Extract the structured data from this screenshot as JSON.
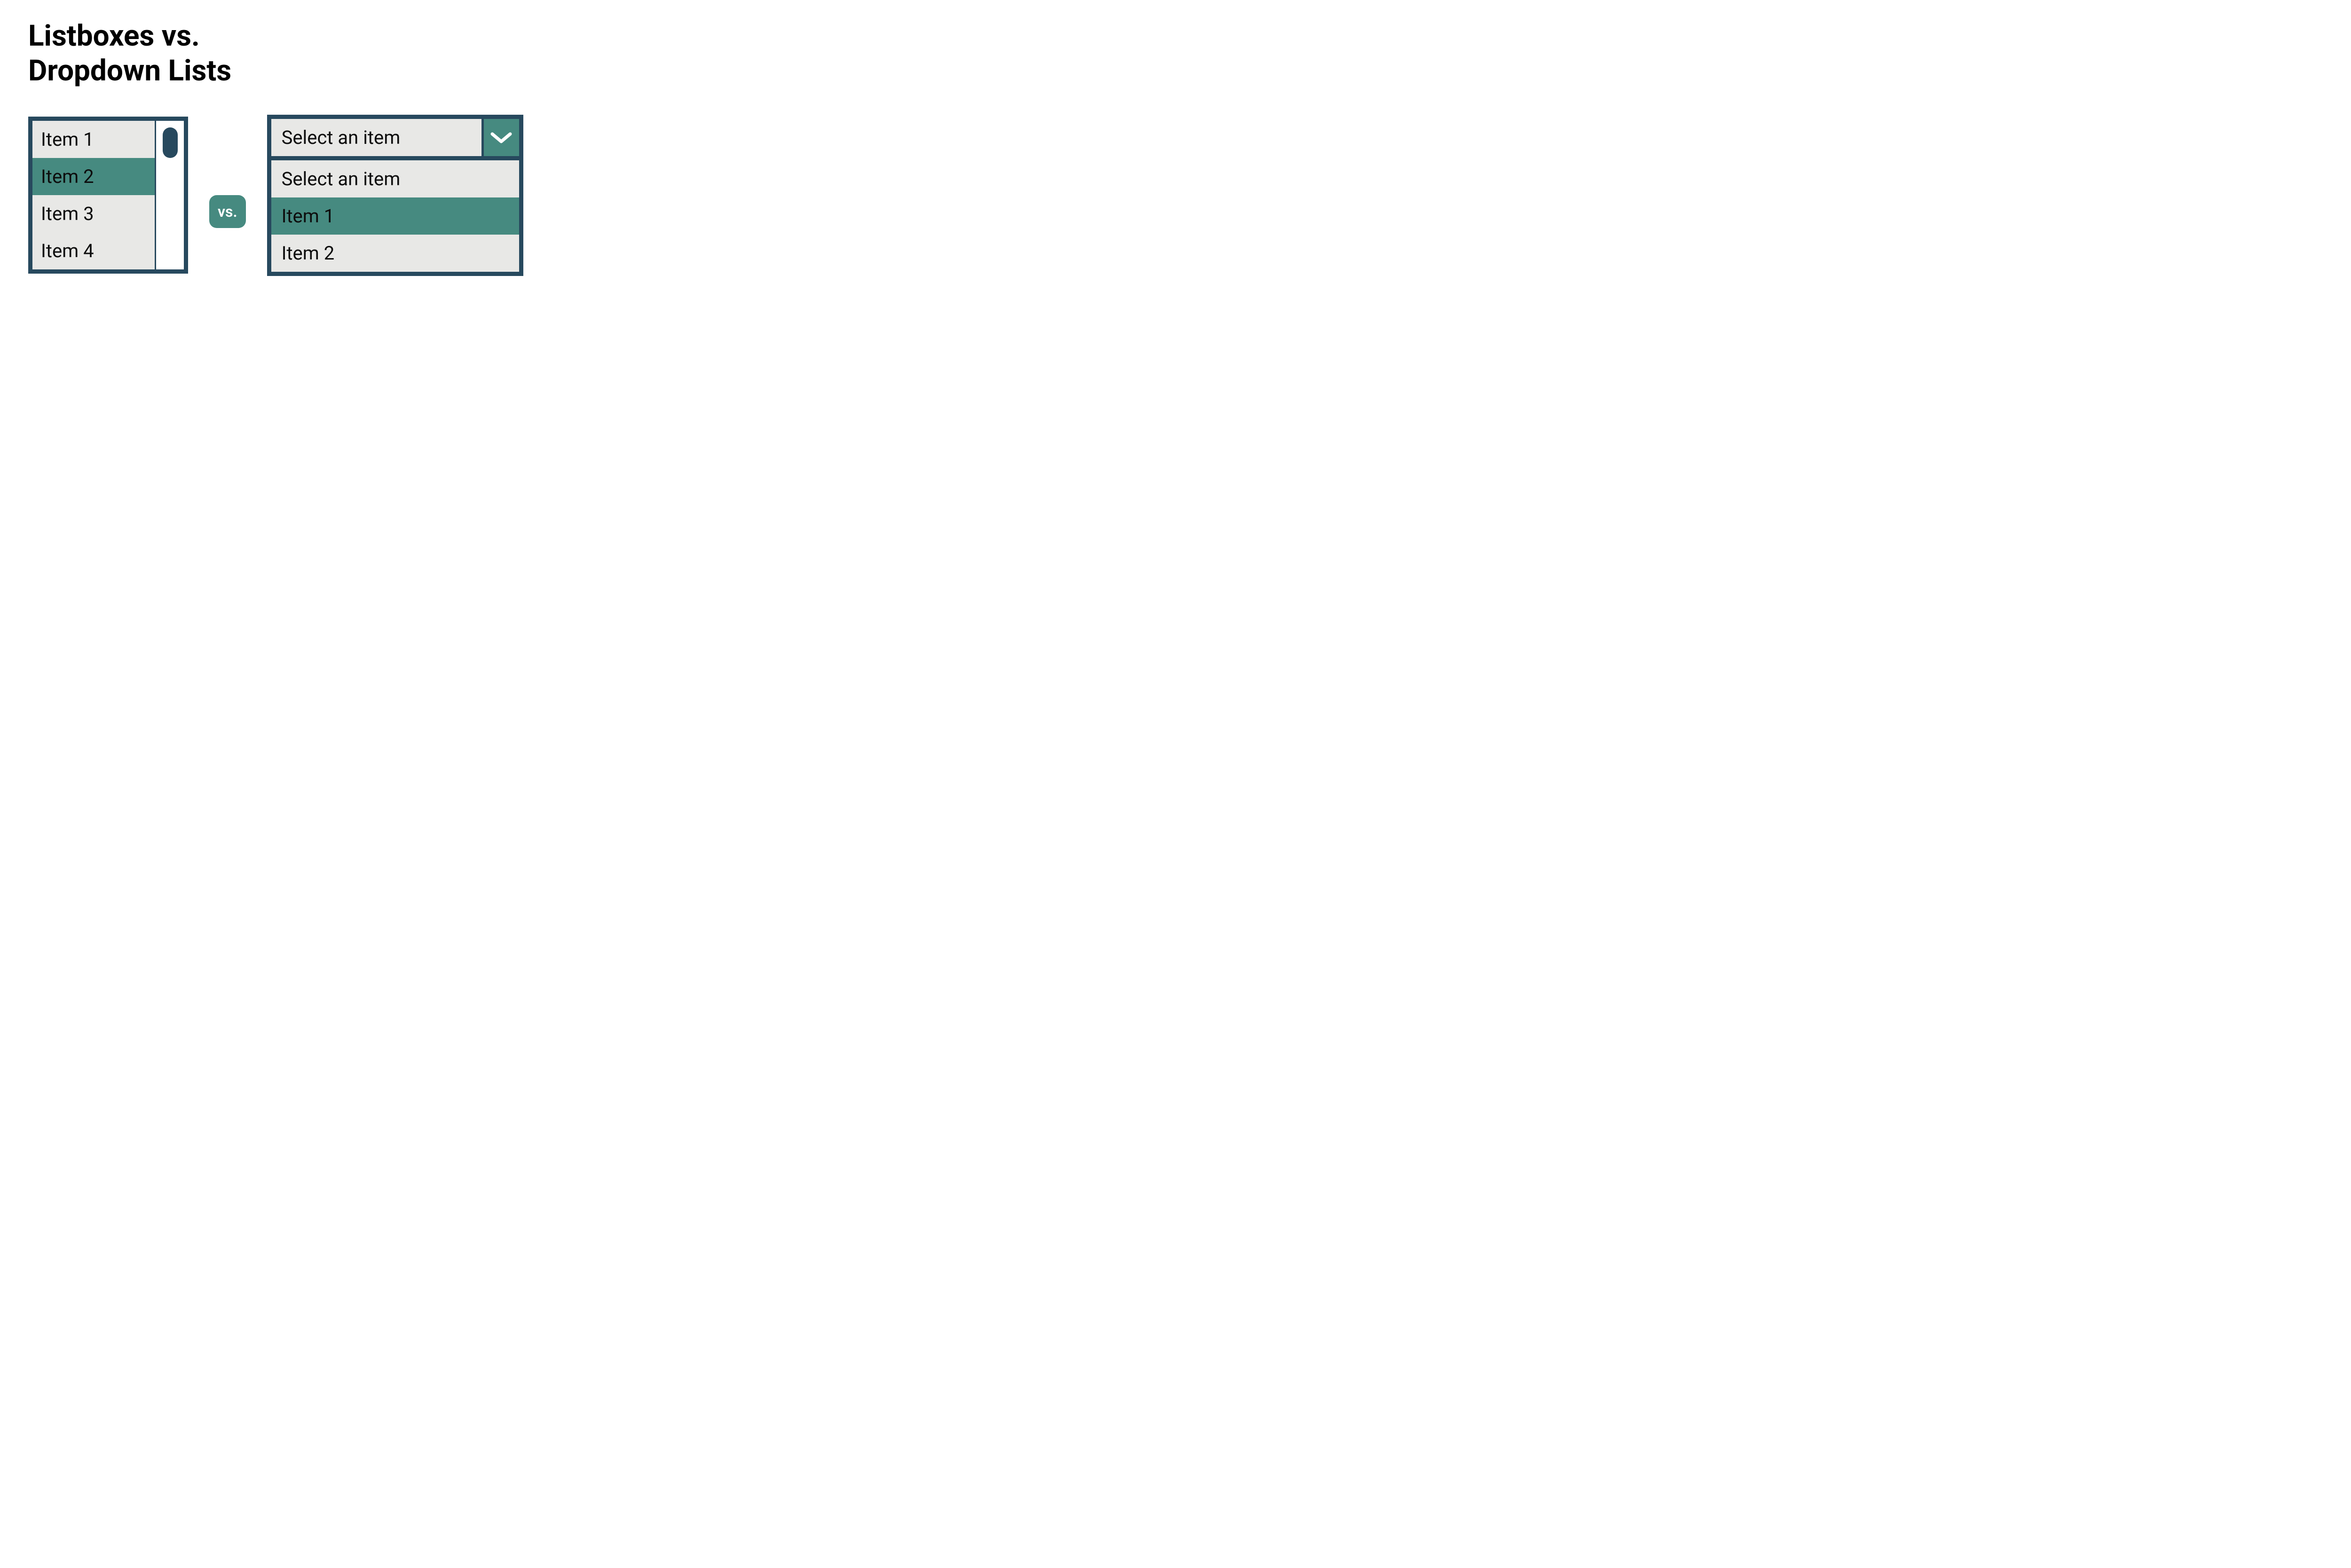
{
  "title_line1": "Listboxes vs.",
  "title_line2": "Dropdown Lists",
  "vs_label": "vs.",
  "listbox": {
    "items": [
      "Item 1",
      "Item 2",
      "Item 3",
      "Item 4"
    ],
    "selected_index": 1
  },
  "dropdown": {
    "placeholder": "Select an item",
    "options": [
      "Select an item",
      "Item 1",
      "Item 2"
    ],
    "highlighted_index": 1
  },
  "colors": {
    "border": "#27495e",
    "accent": "#468a80",
    "item_bg": "#e8e8e6",
    "text": "#0d0d0d"
  }
}
